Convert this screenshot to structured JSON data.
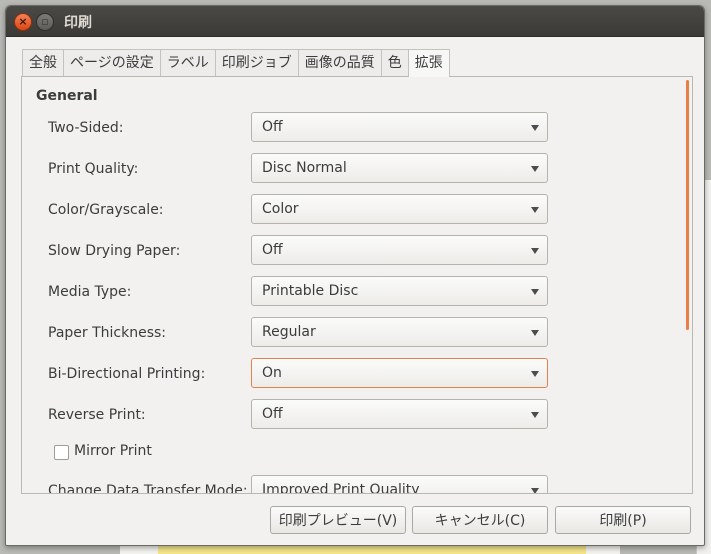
{
  "window": {
    "title": "印刷"
  },
  "tabs": [
    {
      "label": "全般"
    },
    {
      "label": "ページの設定"
    },
    {
      "label": "ラベル"
    },
    {
      "label": "印刷ジョブ"
    },
    {
      "label": "画像の品質"
    },
    {
      "label": "色"
    },
    {
      "label": "拡張"
    }
  ],
  "section": {
    "title": "General"
  },
  "options": [
    {
      "label": "Two-Sided:",
      "value": "Off"
    },
    {
      "label": "Print Quality:",
      "value": "Disc Normal"
    },
    {
      "label": "Color/Grayscale:",
      "value": "Color"
    },
    {
      "label": "Slow Drying Paper:",
      "value": "Off"
    },
    {
      "label": "Media Type:",
      "value": "Printable Disc"
    },
    {
      "label": "Paper Thickness:",
      "value": "Regular"
    },
    {
      "label": "Bi-Directional Printing:",
      "value": "On"
    },
    {
      "label": "Reverse Print:",
      "value": "Off"
    }
  ],
  "mirror_print": {
    "label": "Mirror Print",
    "checked": false
  },
  "transfer_mode": {
    "label": "Change Data Transfer Mode:",
    "value": "Improved Print Quality"
  },
  "buttons": {
    "preview": "印刷プレビュー(V)",
    "cancel": "キャンセル(C)",
    "print": "印刷(P)"
  },
  "colors": {
    "accent": "#e97e49",
    "titlebar": "#3c3b37",
    "close": "#dd4814"
  }
}
